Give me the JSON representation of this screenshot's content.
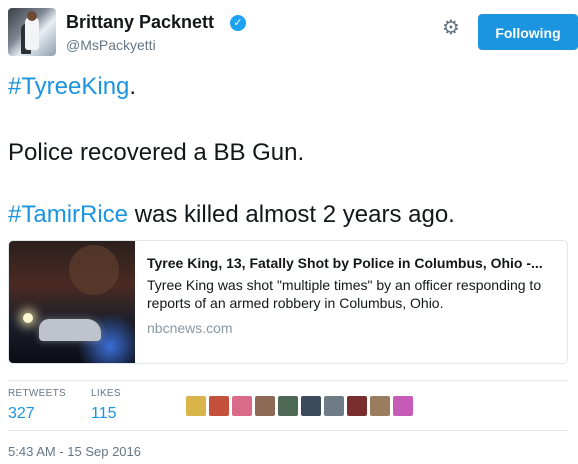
{
  "user": {
    "name": "Brittany Packnett",
    "handle": "@MsPackyetti",
    "verified_icon": "verified-badge-icon"
  },
  "actions": {
    "settings_icon": "gear-icon",
    "follow_label": "Following",
    "accent_color": "#1b95e0"
  },
  "tweet": {
    "line1_hashtag": "#TyreeKing",
    "line1_rest": ".",
    "line2": "Police recovered a BB Gun.",
    "line3_hashtag": "#TamirRice",
    "line3_rest": " was killed almost 2 years ago."
  },
  "card": {
    "title": "Tyree King, 13, Fatally Shot by Police in Columbus, Ohio -...",
    "description": "Tyree King was shot \"multiple times\" by an officer responding to reports of an armed robbery in Columbus, Ohio.",
    "domain": "nbcnews.com"
  },
  "stats": {
    "retweets_label": "RETWEETS",
    "retweets_value": "327",
    "likes_label": "LIKES",
    "likes_value": "115"
  },
  "likers": [
    {
      "name": "liker-avatar",
      "color": "#d9b44a"
    },
    {
      "name": "liker-avatar",
      "color": "#c4513b"
    },
    {
      "name": "liker-avatar",
      "color": "#d86a8a"
    },
    {
      "name": "liker-avatar",
      "color": "#8c6a55"
    },
    {
      "name": "liker-avatar",
      "color": "#4e6a57"
    },
    {
      "name": "liker-avatar",
      "color": "#3c4a5e"
    },
    {
      "name": "liker-avatar",
      "color": "#6e7c86"
    },
    {
      "name": "liker-avatar",
      "color": "#7a2d2d"
    },
    {
      "name": "liker-avatar",
      "color": "#9a7d5e"
    },
    {
      "name": "liker-avatar",
      "color": "#c65bb8"
    }
  ],
  "timestamp": "5:43 AM - 15 Sep 2016"
}
